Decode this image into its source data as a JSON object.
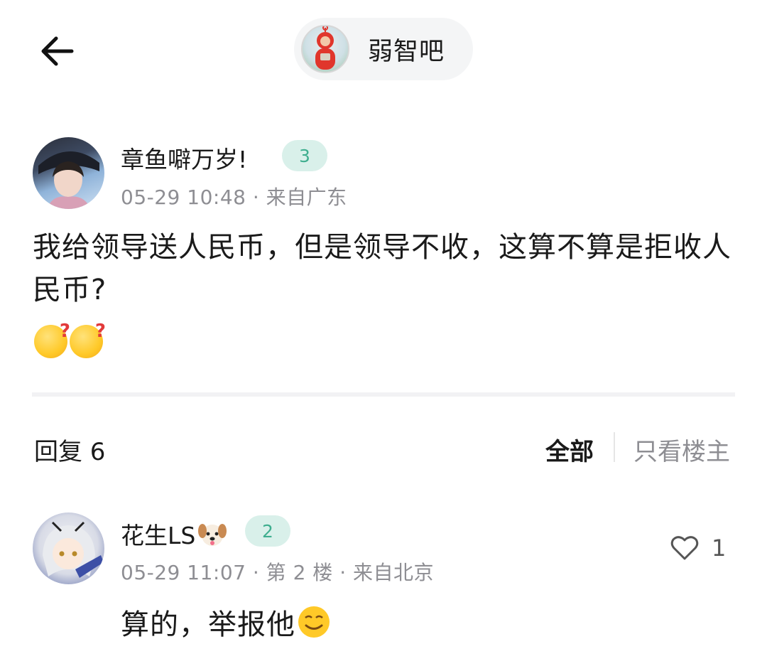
{
  "header": {
    "back_icon": "arrow-left-icon",
    "forum_name": "弱智吧"
  },
  "post": {
    "author": "章鱼噼万岁!",
    "level": "3",
    "time": "05-29 10:48",
    "location": "来自广东",
    "text": "我给领导送人民币，但是领导不收，这算不算是拒收人民币?",
    "emojis": [
      "thinking-question-emoji",
      "thinking-question-emoji"
    ]
  },
  "replies_bar": {
    "count_label": "回复 6",
    "filter_all": "全部",
    "filter_op": "只看楼主"
  },
  "reply": {
    "author": "花生LS",
    "author_emoji": "dog-face-emoji",
    "level": "2",
    "time": "05-29 11:07",
    "floor": "第 2 楼",
    "location": "来自北京",
    "likes": "1",
    "text": "算的，举报他",
    "emoji": "smirk-emoji"
  },
  "colors": {
    "level_bg": "#d9f0ea",
    "level_text": "#3fae8f",
    "meta_text": "#8e8e93"
  }
}
